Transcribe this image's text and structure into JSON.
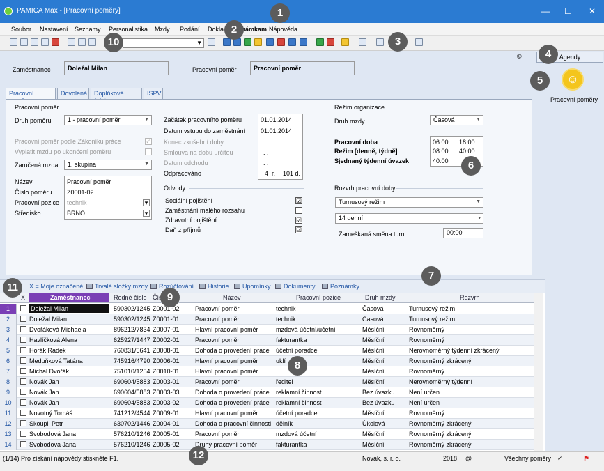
{
  "window": {
    "title": "PAMICA Max - [Pracovní poměry]",
    "minimize": "—",
    "maximize": "☐",
    "close": "✕"
  },
  "menu": [
    "Soubor",
    "Nastavení",
    "Seznamy",
    "Personalistika",
    "Mzdy",
    "Podání",
    "Dokla",
    "známkam",
    "Nápověda"
  ],
  "toolbar": {
    "combo_value": "",
    "icons": [
      "open-icon",
      "save-icon",
      "print-icon",
      "filter-icon",
      "note-icon",
      "help-icon"
    ]
  },
  "copyright": "©",
  "header": {
    "employee_label": "Zaměstnanec",
    "employee_value": "Doležal Milan",
    "relation_label": "Pracovní poměr",
    "relation_value": "Pracovní poměr"
  },
  "sidebar": {
    "agendy": "Agendy",
    "item_label": "Pracovní poměry"
  },
  "tabs": [
    "Pracovní poměr",
    "Dovolená",
    "Doplňkové údaje",
    "ISPV"
  ],
  "form": {
    "section1": "Pracovní poměr",
    "druh_pomeru_label": "Druh poměru",
    "druh_pomeru_value": "1 - pracovní poměr",
    "zakonik_label": "Pracovní poměr podle Zákoníku práce",
    "vyplatit_label": "Vyplatit mzdu po ukončení poměru",
    "zarucena_label": "Zaručená mzda",
    "zarucena_value": "1. skupina",
    "nazev_label": "Název",
    "nazev_value": "Pracovní poměr",
    "cislo_label": "Číslo poměru",
    "cislo_value": "Z0001-02",
    "pozice_label": "Pracovní pozice",
    "pozice_value": "technik",
    "stredisko_label": "Středisko",
    "stredisko_value": "BRNO",
    "zacatek_label": "Začátek pracovního poměru",
    "zacatek_value": "01.01.2014",
    "vstup_label": "Datum vstupu do zaměstnání",
    "vstup_value": "01.01.2014",
    "konec_label": "Konec zkušební doby",
    "konec_value": ". .",
    "smlouva_label": "Smlouva na dobu určitou",
    "smlouva_value": ". .",
    "odchod_label": "Datum odchodu",
    "odchod_value": ". .",
    "odpracovano_label": "Odpracováno",
    "odpracovano_r": "4",
    "odpracovano_r_unit": "r.",
    "odpracovano_d": "101 d.",
    "odvody_label": "Odvody",
    "odvody": [
      {
        "label": "Sociální pojištění",
        "checked": "☑"
      },
      {
        "label": "Zaměstnání malého rozsahu",
        "checked": ""
      },
      {
        "label": "Zdravotní pojištění",
        "checked": "☑"
      },
      {
        "label": "Daň z příjmů",
        "checked": "☑"
      }
    ],
    "rezim_label": "Režim organizace",
    "druh_mzdy_label": "Druh mzdy",
    "druh_mzdy_value": "Časová",
    "prac_doba_label": "Pracovní doba",
    "prac_doba_from": "06:00",
    "prac_doba_to": "18:00",
    "rezim_den_label": "Režim [denně, týdně]",
    "rezim_den_value": "08:00",
    "rezim_tyden_value": "40:00",
    "uvazek_label": "Sjednaný týdenní úvazek",
    "uvazek_value": "40:00",
    "rozvrh_label": "Rozvrh pracovní doby",
    "rozvrh_value": "Turnusový režim",
    "turnus_value": "14 denní",
    "zameskana_label": "Zameškaná směna turn.",
    "zameskana_value": "00:00"
  },
  "bottom_tabs": [
    "X = Moje označené",
    "Trvalé složky mzdy",
    "Rozúčtování",
    "Historie",
    "Upomínky",
    "Dokumenty",
    "Poznámky"
  ],
  "grid": {
    "headers": [
      "X",
      "Zaměstnanec",
      "Rodné číslo",
      "Číslo",
      "Název",
      "Pracovní pozice",
      "Druh mzdy",
      "Rozvrh"
    ],
    "rows": [
      [
        "1",
        "Doležal Milan",
        "590302/1245",
        "Z0001-02",
        "Pracovní poměr",
        "technik",
        "Časová",
        "Turnusový režim"
      ],
      [
        "2",
        "Doležal Milan",
        "590302/1245",
        "Z0001-01",
        "Pracovní poměr",
        "technik",
        "Časová",
        "Turnusový režim"
      ],
      [
        "3",
        "Dvořáková Michaela",
        "896212/7834",
        "Z0007-01",
        "Hlavní pracovní poměr",
        "mzdová účetní/účetní",
        "Měsíční",
        "Rovnoměrný"
      ],
      [
        "4",
        "Havlíčková Alena",
        "625927/1447",
        "Z0002-01",
        "Pracovní poměr",
        "fakturantka",
        "Měsíční",
        "Rovnoměrný"
      ],
      [
        "5",
        "Horák Radek",
        "760831/5641",
        "Z0008-01",
        "Dohoda o provedení práce",
        "účetní poradce",
        "Měsíční",
        "Nerovnoměrný týdenní zkrácený"
      ],
      [
        "6",
        "Meduňková Taťána",
        "745916/4790",
        "Z0006-01",
        "Hlavní pracovní poměr",
        "uklí",
        "Měsíční",
        "Rovnoměrný zkrácený"
      ],
      [
        "7",
        "Michal Dvořák",
        "751010/1254",
        "Z0010-01",
        "Hlavní pracovní poměr",
        "",
        "Měsíční",
        "Rovnoměrný"
      ],
      [
        "8",
        "Novák Jan",
        "690604/5883",
        "Z0003-01",
        "Pracovní poměr",
        "ředitel",
        "Měsíční",
        "Nerovnoměrný týdenní"
      ],
      [
        "9",
        "Novák Jan",
        "690604/5883",
        "Z0003-03",
        "Dohoda o provedení práce",
        "reklamní činnost",
        "Bez úvazku",
        "Není určen"
      ],
      [
        "10",
        "Novák Jan",
        "690604/5883",
        "Z0003-02",
        "Dohoda o provedení práce",
        "reklamní činnost",
        "Bez úvazku",
        "Není určen"
      ],
      [
        "11",
        "Novotný Tomáš",
        "741212/4544",
        "Z0009-01",
        "Hlavní pracovní poměr",
        "účetní poradce",
        "Měsíční",
        "Rovnoměrný"
      ],
      [
        "12",
        "Skoupil Petr",
        "630702/1446",
        "Z0004-01",
        "Dohoda o pracovní činnosti",
        "dělník",
        "Úkolová",
        "Rovnoměrný zkrácený"
      ],
      [
        "13",
        "Svobodová Jana",
        "576210/1246",
        "Z0005-01",
        "Pracovní poměr",
        "mzdová účetní",
        "Měsíční",
        "Rovnoměrný zkrácený"
      ],
      [
        "14",
        "Svobodová Jana",
        "576210/1246",
        "Z0005-02",
        "Druhý pracovní poměr",
        "fakturantka",
        "Měsíční",
        "Rovnoměrný zkrácený"
      ]
    ]
  },
  "status": {
    "left": "(1/14) Pro získání nápovědy stiskněte F1.",
    "company": "Novák, s. r. o.",
    "year": "2018",
    "at": "@",
    "filter": "Všechny poměry"
  },
  "callouts": [
    "1",
    "2",
    "3",
    "4",
    "5",
    "6",
    "7",
    "8",
    "9",
    "10",
    "11",
    "12"
  ]
}
